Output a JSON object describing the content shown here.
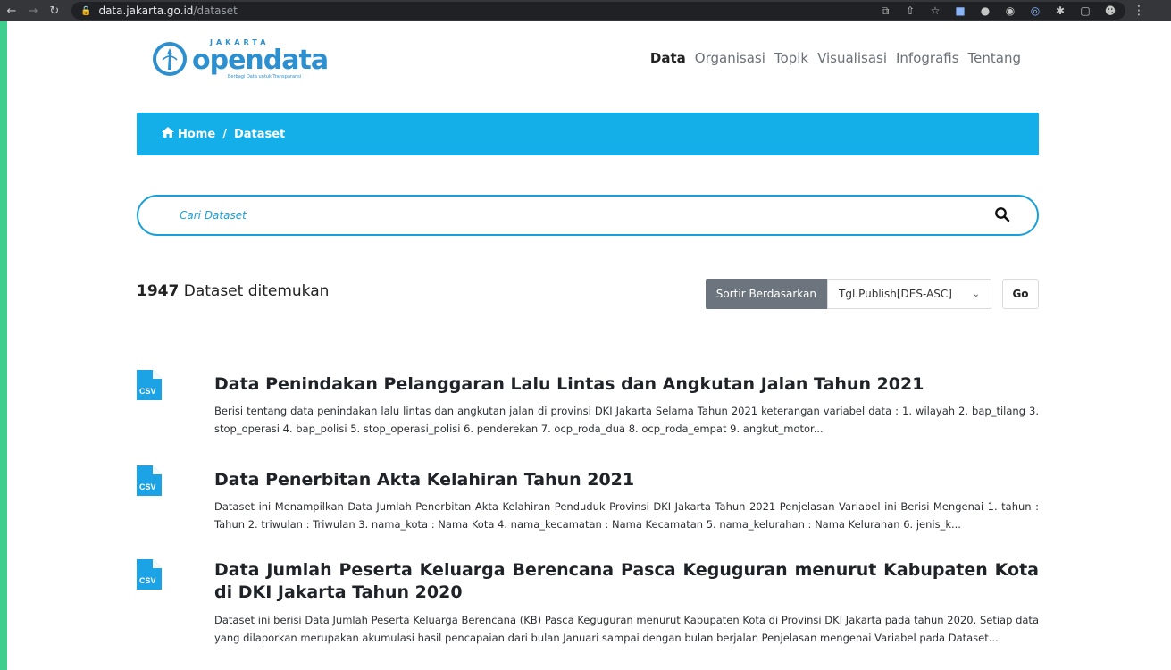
{
  "browser": {
    "url_host": "data.jakarta.go.id",
    "url_path": "/dataset"
  },
  "header": {
    "logo_top": "JAKARTA",
    "logo_main": "opendata",
    "logo_tagline": "Berbagi Data untuk Transparansi",
    "nav": [
      {
        "label": "Data",
        "active": true
      },
      {
        "label": "Organisasi",
        "active": false
      },
      {
        "label": "Topik",
        "active": false
      },
      {
        "label": "Visualisasi",
        "active": false
      },
      {
        "label": "Infografis",
        "active": false
      },
      {
        "label": "Tentang",
        "active": false
      }
    ]
  },
  "breadcrumb": {
    "home": "Home",
    "separator": "/",
    "current": "Dataset"
  },
  "search": {
    "placeholder": "Cari Dataset"
  },
  "results": {
    "count": "1947",
    "count_suffix": " Dataset ditemukan",
    "sort_label": "Sortir Berdasarkan",
    "sort_value": "Tgl.Publish[DES-ASC]",
    "go_label": "Go"
  },
  "datasets": [
    {
      "format": "CSV",
      "title": "Data Penindakan Pelanggaran Lalu Lintas dan Angkutan Jalan Tahun 2021",
      "description": "Berisi tentang data penindakan lalu lintas dan angkutan jalan di provinsi DKI Jakarta Selama Tahun 2021 keterangan variabel data : 1. wilayah 2. bap_tilang 3. stop_operasi 4. bap_polisi 5. stop_operasi_polisi 6. penderekan 7. ocp_roda_dua 8. ocp_roda_empat 9. angkut_motor..."
    },
    {
      "format": "CSV",
      "title": "Data Penerbitan Akta Kelahiran Tahun 2021",
      "description": "Dataset ini Menampilkan Data Jumlah Penerbitan Akta Kelahiran Penduduk Provinsi DKI Jakarta Tahun 2021 Penjelasan Variabel ini Berisi Mengenai 1. tahun : Tahun 2. triwulan : Triwulan 3. nama_kota : Nama Kota 4. nama_kecamatan : Nama Kecamatan 5. nama_kelurahan : Nama Kelurahan 6. jenis_k..."
    },
    {
      "format": "CSV",
      "title": "Data Jumlah Peserta Keluarga Berencana Pasca Keguguran menurut Kabupaten Kota di DKI Jakarta Tahun 2020",
      "description": "Dataset ini berisi Data Jumlah Peserta Keluarga Berencana (KB) Pasca Keguguran menurut Kabupaten Kota di Provinsi DKI Jakarta pada tahun 2020. Setiap data yang dilaporkan merupakan akumulasi hasil pencapaian dari bulan Januari sampai dengan bulan berjalan Penjelasan mengenai Variabel pada Dataset..."
    }
  ],
  "colors": {
    "brand": "#2b8fd0",
    "breadcrumb_bg": "#14aee8",
    "search_border": "#1aa0d8",
    "sort_label_bg": "#6c757d",
    "csv_icon": "#1ca3e6",
    "page_border": "#3ecf8e"
  }
}
